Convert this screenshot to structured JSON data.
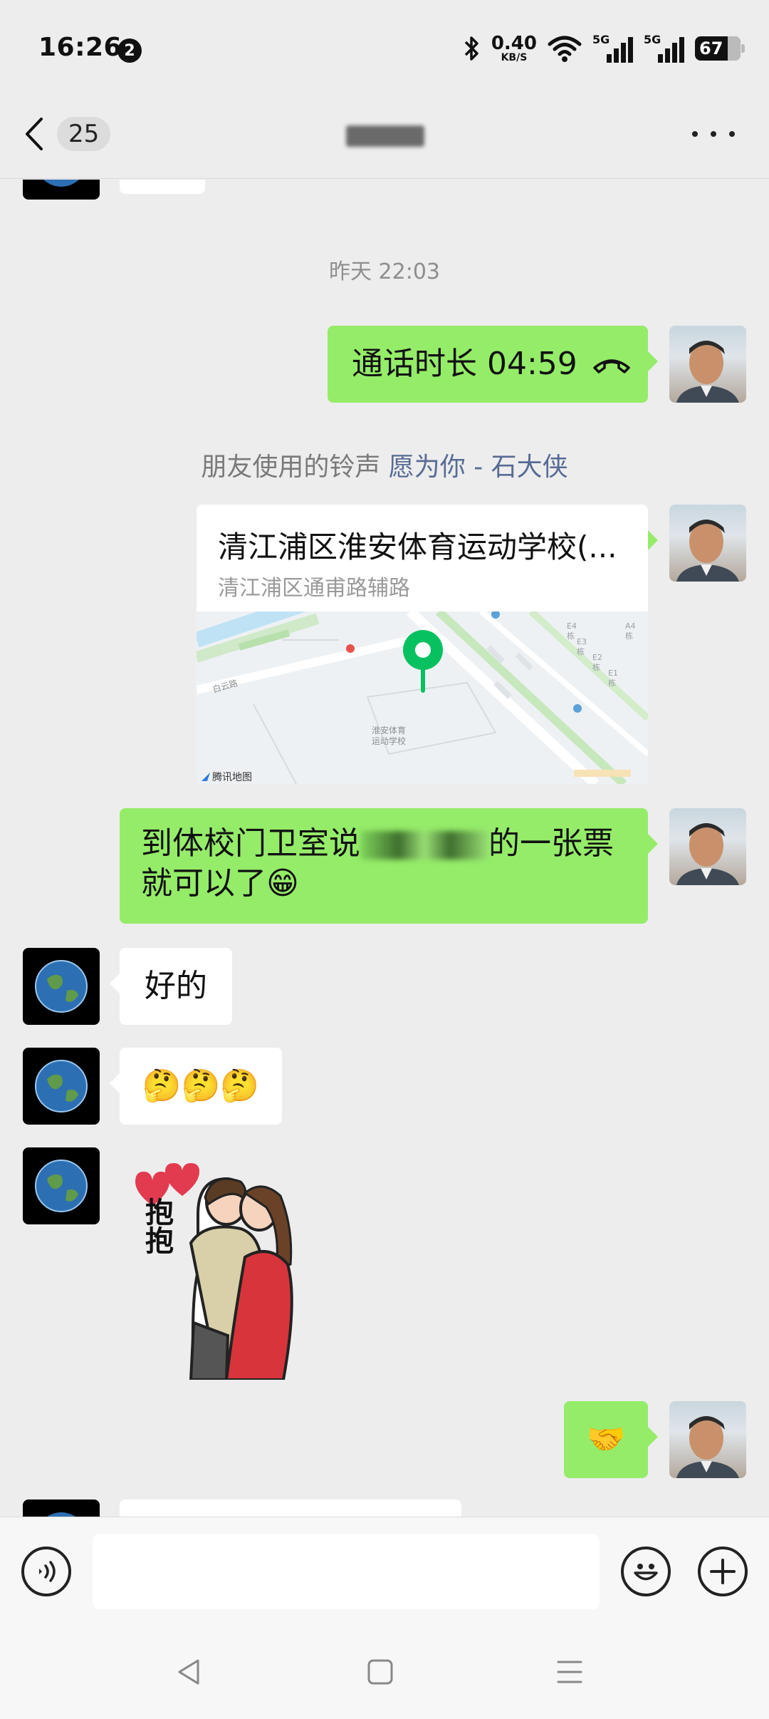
{
  "status_bar": {
    "time": "16:26",
    "notification_count": "2",
    "net_speed_value": "0.40",
    "net_speed_unit": "KB/S",
    "signal1_label": "5G",
    "signal2_label": "5G",
    "battery_level": "67"
  },
  "nav": {
    "back_count": "25",
    "title": ""
  },
  "chat": {
    "timestamp": "昨天 22:03",
    "call_record": "通话时长 04:59",
    "ringtone_prefix": "朋友使用的铃声",
    "ringtone_song": "愿为你 - 石大侠",
    "location": {
      "name": "清江浦区淮安体育运动学校(...",
      "address": "清江浦区通甫路辅路",
      "map_place_label": "淮安体育\n运动学校",
      "map_road_label": "白云路",
      "map_attribution": "腾讯地图",
      "map_building_labels": [
        "E4栋",
        "A4栋",
        "E3栋",
        "E2栋",
        "E1栋"
      ]
    },
    "sent_message_part1": "到体校门卫室说",
    "sent_message_part2": "的一张票",
    "sent_message_line2": "就可以了😁",
    "reply_ok": "好的",
    "reply_emojis": "🤔🤔🤔",
    "sticker_text": "抱抱",
    "sent_emoji": "🤝"
  },
  "colors": {
    "background": "#ededed",
    "bubble_green": "#95ec69",
    "bubble_white": "#ffffff",
    "link_blue": "#576b95"
  }
}
